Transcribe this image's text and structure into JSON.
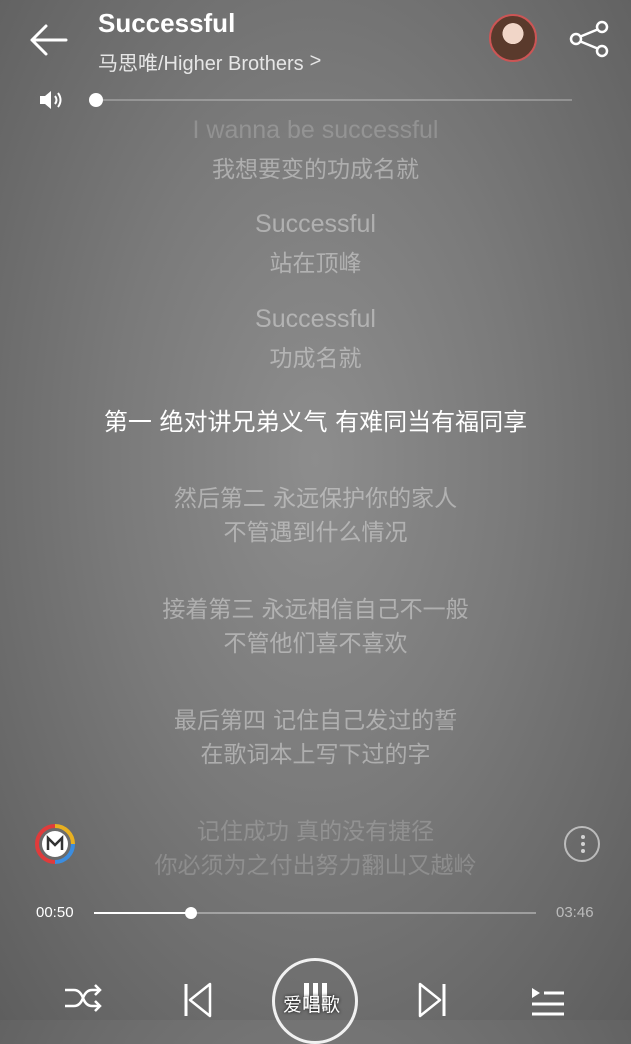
{
  "header": {
    "title": "Successful",
    "artist": "马思唯/Higher Brothers",
    "artist_chevron": ">"
  },
  "lyrics": [
    {
      "text": "I wanna be successful",
      "type": "en",
      "state": "faint"
    },
    {
      "text": "我想要变的功成名就",
      "type": "zh",
      "state": "normal"
    },
    {
      "text": "Successful",
      "type": "en",
      "state": "normal"
    },
    {
      "text": "站在顶峰",
      "type": "zh",
      "state": "normal"
    },
    {
      "text": "Successful",
      "type": "en",
      "state": "normal"
    },
    {
      "text": "功成名就",
      "type": "zh",
      "state": "normal"
    },
    {
      "text": "第一 绝对讲兄弟义气 有难同当有福同享",
      "type": "zh",
      "state": "current"
    },
    {
      "text": "然后第二 永远保护你的家人",
      "type": "zh",
      "state": "normal"
    },
    {
      "text": "不管遇到什么情况",
      "type": "zh",
      "state": "normal"
    },
    {
      "text": "接着第三 永远相信自己不一般",
      "type": "zh",
      "state": "normal"
    },
    {
      "text": "不管他们喜不喜欢",
      "type": "zh",
      "state": "normal"
    },
    {
      "text": "最后第四 记住自己发过的誓",
      "type": "zh",
      "state": "normal"
    },
    {
      "text": "在歌词本上写下过的字",
      "type": "zh",
      "state": "normal"
    },
    {
      "text": "记住成功 真的没有捷径",
      "type": "zh",
      "state": "faint"
    },
    {
      "text": "你必须为之付出努力翻山又越岭",
      "type": "zh",
      "state": "faint"
    }
  ],
  "player": {
    "current_time": "00:50",
    "total_time": "03:46",
    "progress": 0.22,
    "volume": 0.0
  },
  "watermark": "爱唱歌",
  "icons": {
    "back": "arrow-left-icon",
    "share": "share-icon",
    "volume": "speaker-icon",
    "shuffle": "shuffle-icon",
    "prev": "skip-previous-icon",
    "pause": "pause-icon",
    "next": "skip-next-icon",
    "playlist": "playlist-icon",
    "more": "more-vertical-icon",
    "app": "app-logo-icon"
  }
}
